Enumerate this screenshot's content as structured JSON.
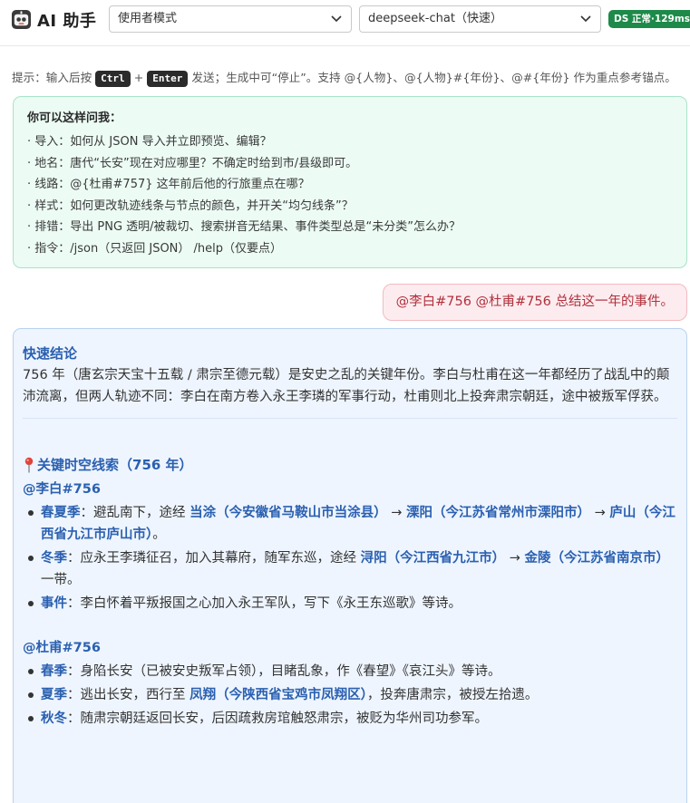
{
  "header": {
    "app_title": "AI 助手",
    "mode_select": {
      "value": "使用者模式"
    },
    "model_select": {
      "value": "deepseek-chat（快速）"
    },
    "status_badge": "DS 正常·129ms",
    "status_color": "#1e8a4a"
  },
  "hint": {
    "prefix": "提示：输入后按",
    "key1": "Ctrl",
    "plus": "+",
    "key2": "Enter",
    "suffix": "发送；生成中可“停止”。支持 @{人物}、@{人物}#{年份}、@#{年份} 作为重点参考锚点。"
  },
  "suggestions": {
    "title": "你可以这样问我：",
    "items": [
      "· 导入：如何从 JSON 导入并立即预览、编辑？",
      "· 地名：唐代“长安”现在对应哪里？不确定时给到市/县级即可。",
      "· 线路：@{杜甫#757} 这年前后他的行旅重点在哪？",
      "· 样式：如何更改轨迹线条与节点的颜色，并开关“均匀线条”？",
      "· 排错：导出 PNG 透明/被裁切、搜索拼音无结果、事件类型总是“未分类”怎么办？",
      "· 指令：/json（只返回 JSON） /help（仅要点）"
    ]
  },
  "user_message": "@李白#756 @杜甫#756 总结这一年的事件。",
  "answer": {
    "quick_title": "快速结论",
    "summary": "756 年（唐玄宗天宝十五载 / 肃宗至德元载）是安史之乱的关键年份。李白与杜甫在这一年都经历了战乱中的颠沛流离，但两人轨迹不同：李白在南方卷入永王李璘的军事行动，杜甫则北上投奔肃宗朝廷，途中被叛军俘获。",
    "timeline_title": "关键时空线索（756 年）",
    "libai": {
      "heading": "@李白#756",
      "b1_season": "春夏季",
      "b1_text1": "：避乱南下，途经 ",
      "b1_place1": "当涂（今安徽省马鞍山市当涂县）",
      "b1_arrow1": " → ",
      "b1_place2": "溧阳（今江苏省常州市溧阳市）",
      "b1_arrow2": " → ",
      "b1_place3": "庐山（今江西省九江市庐山市）",
      "b1_end": "。",
      "b2_season": "冬季",
      "b2_text1": "：应永王李璘征召，加入其幕府，随军东巡，途经 ",
      "b2_place1": "浔阳（今江西省九江市）",
      "b2_arrow": " → ",
      "b2_place2": "金陵（今江苏省南京市）",
      "b2_end": " 一带。",
      "b3_season": "事件",
      "b3_text": "：李白怀着平叛报国之心加入永王军队，写下《永王东巡歌》等诗。"
    },
    "dufu": {
      "heading": "@杜甫#756",
      "b1_season": "春季",
      "b1_text": "：身陷长安（已被安史叛军占领），目睹乱象，作《春望》《哀江头》等诗。",
      "b2_season": "夏季",
      "b2_text1": "：逃出长安，西行至 ",
      "b2_place": "凤翔（今陕西省宝鸡市凤翔区）",
      "b2_end": "，投奔唐肃宗，被授左拾遗。",
      "b3_season": "秋冬",
      "b3_text": "：随肃宗朝廷返回长安，后因疏救房琯触怒肃宗，被贬为华州司功参军。"
    }
  },
  "colors": {
    "accent_blue": "#2b60b0",
    "suggest_bg": "#ecfbf4",
    "user_bubble_text": "#b0303c",
    "answer_bg": "#eef5fe"
  }
}
